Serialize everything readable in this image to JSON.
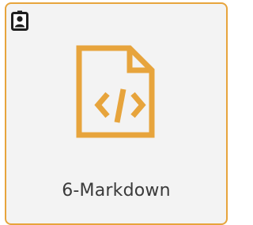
{
  "tile": {
    "label": "6-Markdown",
    "file_type_icon": "code-file-icon",
    "badge_icon": "contact-badge-icon"
  },
  "colors": {
    "accent": "#e7a43c",
    "tile_background": "#f3f3f3",
    "label_text": "#3a3a3a",
    "badge_dark": "#1f1f1f"
  }
}
